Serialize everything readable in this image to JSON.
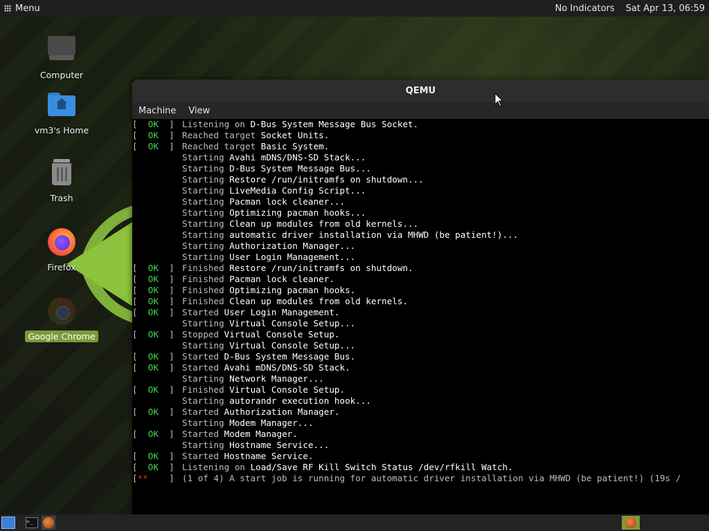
{
  "topbar": {
    "menu_label": "Menu",
    "indicators": "No Indicators",
    "datetime": "Sat Apr 13, 06:59"
  },
  "desktop_icons": [
    {
      "label": "Computer",
      "icon": "computer-icon"
    },
    {
      "label": "vm3's Home",
      "icon": "home-folder-icon"
    },
    {
      "label": "Trash",
      "icon": "trash-icon"
    },
    {
      "label": "Firefox",
      "icon": "firefox-icon"
    },
    {
      "label": "Google Chrome",
      "icon": "chrome-icon"
    }
  ],
  "window": {
    "title": "QEMU",
    "menu": [
      "Machine",
      "View"
    ]
  },
  "console": [
    {
      "status": "[  OK  ]",
      "kind": "ok",
      "verb": "Listening on",
      "target": "D-Bus System Message Bus Socket."
    },
    {
      "status": "[  OK  ]",
      "kind": "ok",
      "verb": "Reached target",
      "target": "Socket Units."
    },
    {
      "status": "[  OK  ]",
      "kind": "ok",
      "verb": "Reached target",
      "target": "Basic System."
    },
    {
      "status": "",
      "kind": "none",
      "verb": "Starting",
      "target": "Avahi mDNS/DNS-SD Stack..."
    },
    {
      "status": "",
      "kind": "none",
      "verb": "Starting",
      "target": "D-Bus System Message Bus..."
    },
    {
      "status": "",
      "kind": "none",
      "verb": "Starting",
      "target": "Restore /run/initramfs on shutdown..."
    },
    {
      "status": "",
      "kind": "none",
      "verb": "Starting",
      "target": "LiveMedia Config Script..."
    },
    {
      "status": "",
      "kind": "none",
      "verb": "Starting",
      "target": "Pacman lock cleaner..."
    },
    {
      "status": "",
      "kind": "none",
      "verb": "Starting",
      "target": "Optimizing pacman hooks..."
    },
    {
      "status": "",
      "kind": "none",
      "verb": "Starting",
      "target": "Clean up modules from old kernels..."
    },
    {
      "status": "",
      "kind": "none",
      "verb": "Starting",
      "target": "automatic driver installation via MHWD (be patient!)..."
    },
    {
      "status": "",
      "kind": "none",
      "verb": "Starting",
      "target": "Authorization Manager..."
    },
    {
      "status": "",
      "kind": "none",
      "verb": "Starting",
      "target": "User Login Management..."
    },
    {
      "status": "[  OK  ]",
      "kind": "ok",
      "verb": "Finished",
      "target": "Restore /run/initramfs on shutdown."
    },
    {
      "status": "[  OK  ]",
      "kind": "ok",
      "verb": "Finished",
      "target": "Pacman lock cleaner."
    },
    {
      "status": "[  OK  ]",
      "kind": "ok",
      "verb": "Finished",
      "target": "Optimizing pacman hooks."
    },
    {
      "status": "[  OK  ]",
      "kind": "ok",
      "verb": "Finished",
      "target": "Clean up modules from old kernels."
    },
    {
      "status": "[  OK  ]",
      "kind": "ok",
      "verb": "Started",
      "target": "User Login Management."
    },
    {
      "status": "",
      "kind": "none",
      "verb": "Starting",
      "target": "Virtual Console Setup..."
    },
    {
      "status": "[  OK  ]",
      "kind": "ok",
      "verb": "Stopped",
      "target": "Virtual Console Setup."
    },
    {
      "status": "",
      "kind": "none",
      "verb": "Starting",
      "target": "Virtual Console Setup..."
    },
    {
      "status": "[  OK  ]",
      "kind": "ok",
      "verb": "Started",
      "target": "D-Bus System Message Bus."
    },
    {
      "status": "[  OK  ]",
      "kind": "ok",
      "verb": "Started",
      "target": "Avahi mDNS/DNS-SD Stack."
    },
    {
      "status": "",
      "kind": "none",
      "verb": "Starting",
      "target": "Network Manager..."
    },
    {
      "status": "[  OK  ]",
      "kind": "ok",
      "verb": "Finished",
      "target": "Virtual Console Setup."
    },
    {
      "status": "",
      "kind": "none",
      "verb": "Starting",
      "target": "autorandr execution hook..."
    },
    {
      "status": "[  OK  ]",
      "kind": "ok",
      "verb": "Started",
      "target": "Authorization Manager."
    },
    {
      "status": "",
      "kind": "none",
      "verb": "Starting",
      "target": "Modem Manager..."
    },
    {
      "status": "[  OK  ]",
      "kind": "ok",
      "verb": "Started",
      "target": "Modem Manager."
    },
    {
      "status": "",
      "kind": "none",
      "verb": "Starting",
      "target": "Hostname Service..."
    },
    {
      "status": "[  OK  ]",
      "kind": "ok",
      "verb": "Started",
      "target": "Hostname Service."
    },
    {
      "status": "[  OK  ]",
      "kind": "ok",
      "verb": "Listening on",
      "target": "Load/Save RF Kill Switch Status /dev/rfkill Watch."
    },
    {
      "status": "[**    ]",
      "kind": "fail",
      "verb": "",
      "target": "(1 of 4) A start job is running for automatic driver installation via MHWD (be patient!) (19s /"
    }
  ],
  "taskbar": {
    "items": [
      "show-desktop-icon",
      "terminal-icon",
      "qemu-app-icon"
    ],
    "tray_item": "qemu-tray-icon"
  },
  "colors": {
    "accent_green": "#7a9a3a",
    "ok_green": "#3fd64f",
    "fail_red": "#e03030"
  }
}
